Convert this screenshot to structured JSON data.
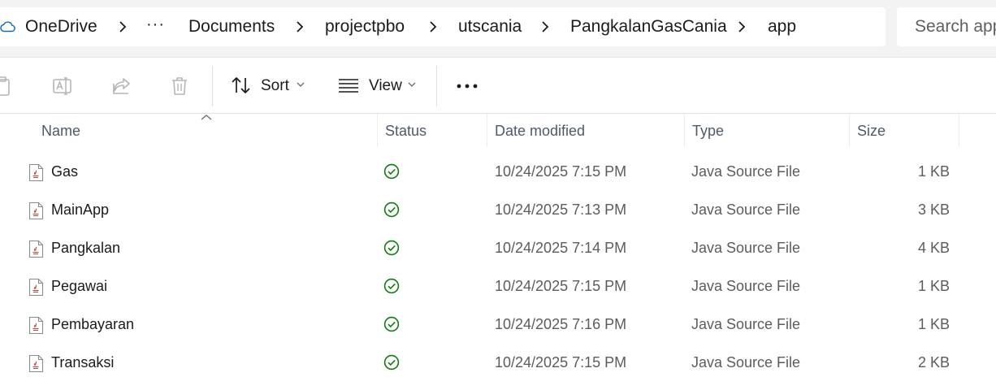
{
  "breadcrumb": {
    "items": [
      "OneDrive",
      "Documents",
      "projectpbo",
      "utscania",
      "PangkalanGasCania",
      "app"
    ],
    "overflow": "···"
  },
  "search": {
    "placeholder": "Search app"
  },
  "toolbar": {
    "sort_label": "Sort",
    "view_label": "View",
    "icons": [
      "paste-icon",
      "rename-icon",
      "share-icon",
      "delete-icon",
      "sort-icon",
      "view-icon",
      "more-icon"
    ]
  },
  "columns": {
    "name": "Name",
    "status": "Status",
    "date": "Date modified",
    "type": "Type",
    "size": "Size"
  },
  "files": [
    {
      "name": "Gas",
      "date": "10/24/2025 7:15 PM",
      "type": "Java Source File",
      "size": "1 KB"
    },
    {
      "name": "MainApp",
      "date": "10/24/2025 7:13 PM",
      "type": "Java Source File",
      "size": "3 KB"
    },
    {
      "name": "Pangkalan",
      "date": "10/24/2025 7:14 PM",
      "type": "Java Source File",
      "size": "4 KB"
    },
    {
      "name": "Pegawai",
      "date": "10/24/2025 7:15 PM",
      "type": "Java Source File",
      "size": "1 KB"
    },
    {
      "name": "Pembayaran",
      "date": "10/24/2025 7:16 PM",
      "type": "Java Source File",
      "size": "1 KB"
    },
    {
      "name": "Transaksi",
      "date": "10/24/2025 7:15 PM",
      "type": "Java Source File",
      "size": "2 KB"
    }
  ],
  "colors": {
    "accent": "#0f6cbd",
    "status_ok": "#0f7b0f",
    "java_red": "#c4453b"
  }
}
